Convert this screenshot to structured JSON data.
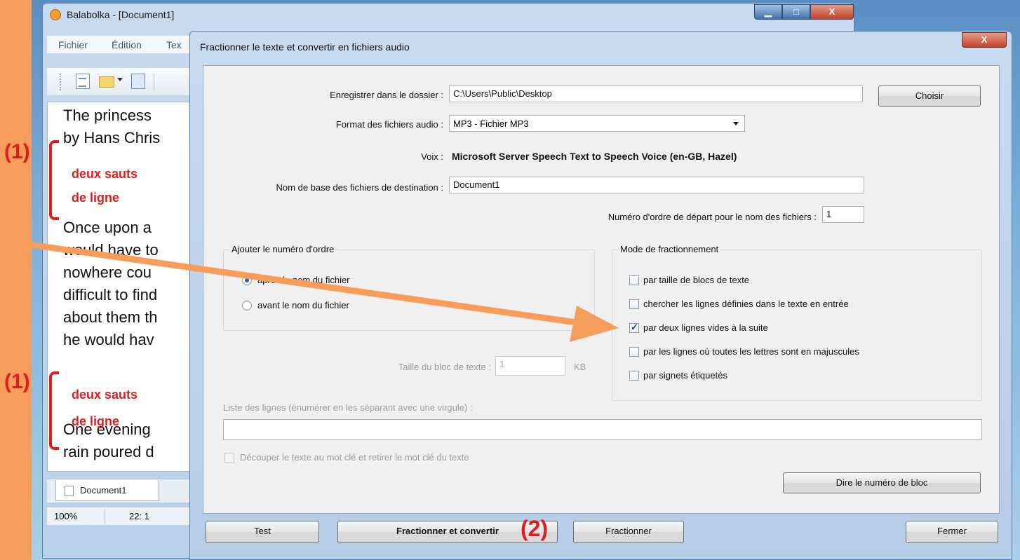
{
  "main_window": {
    "title": "Balabolka - [Document1]",
    "minimize": "▁",
    "maximize": "□",
    "close": "X",
    "menu": [
      "Fichier",
      "Édition",
      "Tex"
    ],
    "editor_lines": [
      "The princess",
      "by Hans Chris",
      "Once upon a",
      "would have to",
      "nowhere cou",
      "difficult to find",
      "about them th",
      "he would hav",
      "One evening",
      "rain poured d"
    ],
    "doc_tab": "Document1",
    "status": {
      "zoom": "100%",
      "position": "22:  1"
    }
  },
  "dialog": {
    "title": "Fractionner le texte et convertir en fichiers audio",
    "close": "X",
    "folder": {
      "label": "Enregistrer dans le dossier :",
      "value": "C:\\Users\\Public\\Desktop",
      "button": "Choisir"
    },
    "format": {
      "label": "Format des fichiers audio :",
      "value": "MP3 - Fichier MP3"
    },
    "voice": {
      "label": "Voix :",
      "value": "Microsoft Server Speech Text to Speech Voice (en-GB, Hazel)"
    },
    "basename": {
      "label": "Nom de base des fichiers de destination :",
      "value": "Document1"
    },
    "start_number": {
      "label": "Numéro d'ordre de départ pour le nom des fichiers :",
      "value": "1"
    },
    "order_group": {
      "title": "Ajouter le numéro d'ordre",
      "after": "après le nom du fichier",
      "before": "avant le nom du fichier",
      "selected": "after"
    },
    "split_group": {
      "title": "Mode de fractionnement",
      "options": [
        {
          "label": "par taille de blocs de texte",
          "checked": false
        },
        {
          "label": "chercher les lignes définies dans le texte en entrée",
          "checked": false
        },
        {
          "label": "par deux lignes vides à la suite",
          "checked": true
        },
        {
          "label": "par les lignes où toutes les lettres sont en majuscules",
          "checked": false
        },
        {
          "label": "par signets étiquetés",
          "checked": false
        }
      ]
    },
    "block_size": {
      "label": "Taille du bloc de texte :",
      "value": "1",
      "unit": "KB"
    },
    "lines_list": {
      "label": "Liste des lignes (énumérer en les séparant avec une virgule) :",
      "value": ""
    },
    "keyword_cut": {
      "label": "Découper le texte au mot clé et retirer le mot clé du texte"
    },
    "say_block": "Dire le numéro de bloc",
    "buttons": {
      "test": "Test",
      "split_convert": "Fractionner et convertir",
      "split": "Fractionner",
      "close": "Fermer"
    }
  },
  "annotations": {
    "note1_num": "(1)",
    "note1_text": [
      "deux sauts",
      "de ligne"
    ],
    "note2_num": "(1)",
    "note2_text": [
      "deux sauts",
      "de ligne"
    ],
    "note3_num": "(2)",
    "color": "#e01d1d",
    "arrow_color": "#f79d5c"
  }
}
